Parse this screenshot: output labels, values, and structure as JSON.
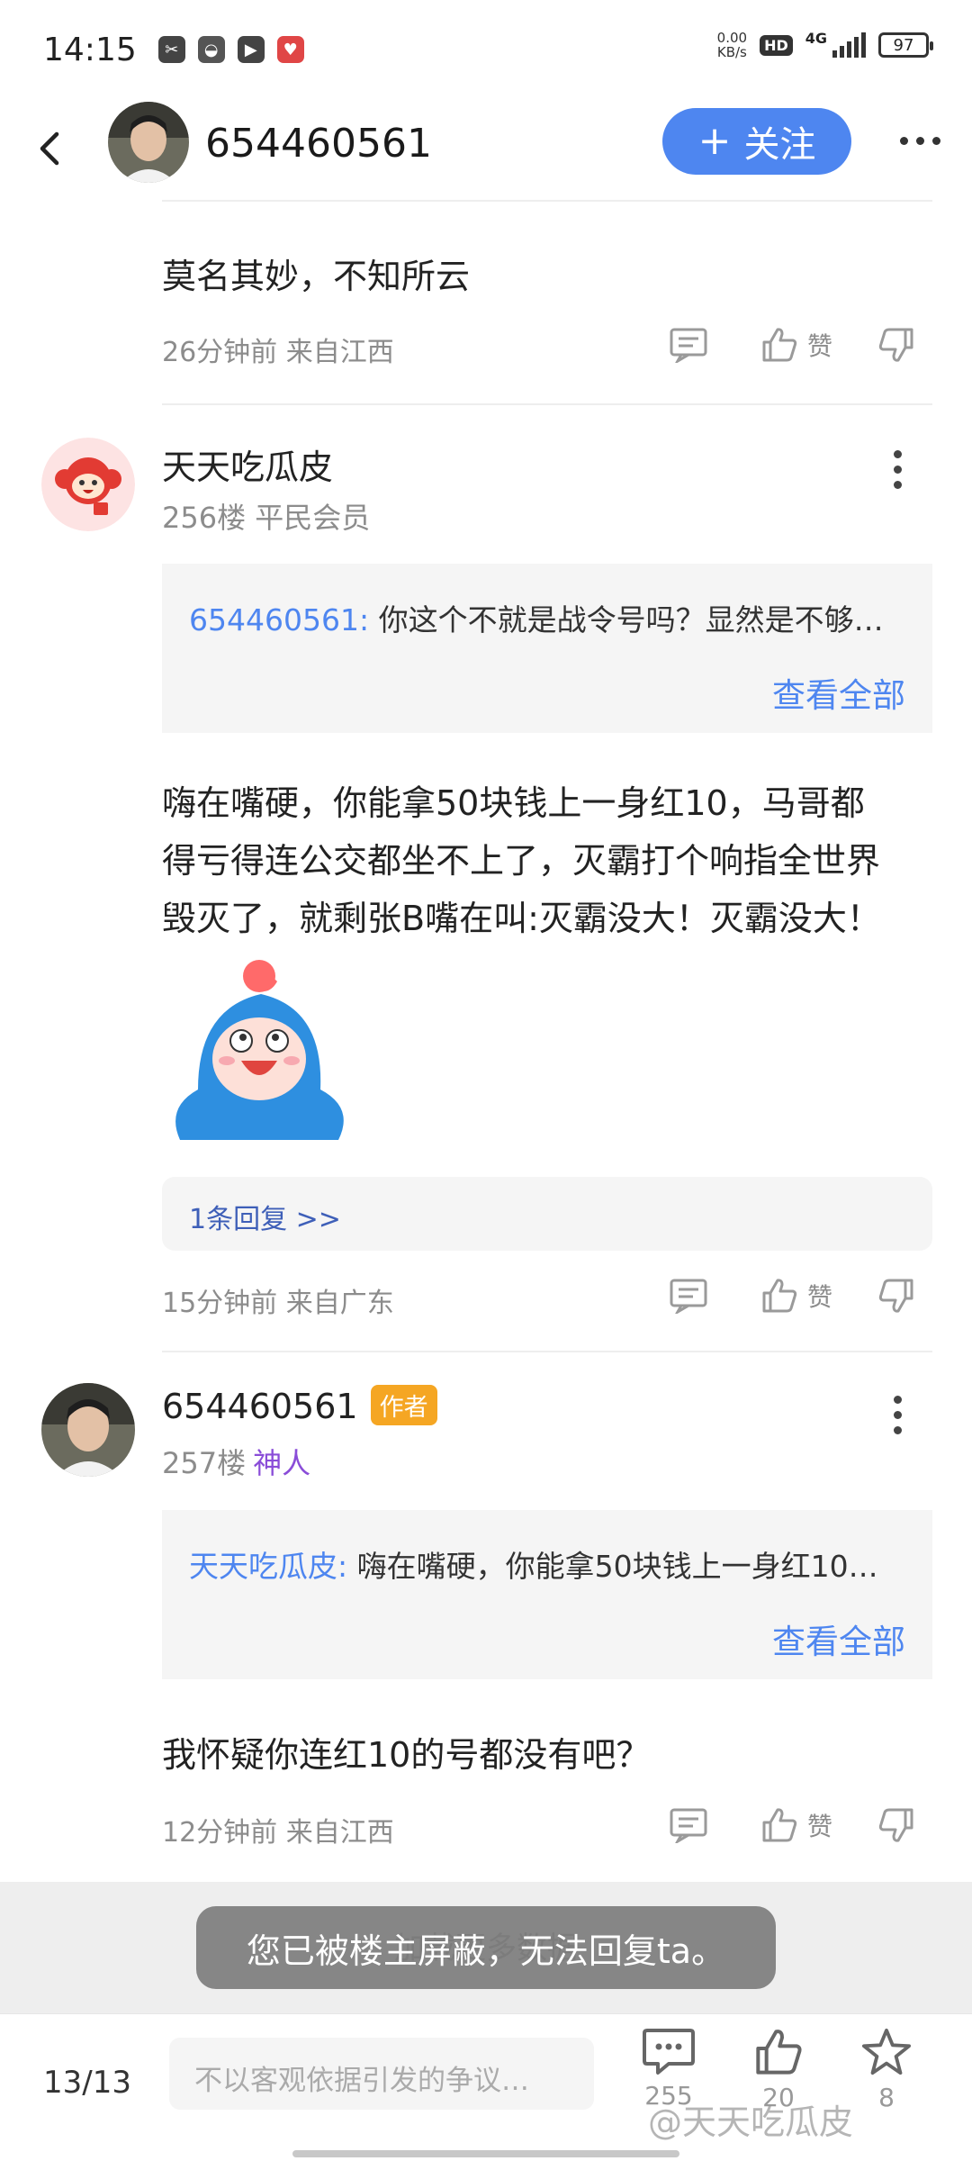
{
  "status": {
    "time": "14:15",
    "net_speed_value": "0.00",
    "net_speed_unit": "KB/s",
    "hd": "HD",
    "network": "4G",
    "battery": "97"
  },
  "header": {
    "username": "654460561",
    "follow_label": "关注",
    "follow_plus": "+"
  },
  "post_top": {
    "text": "莫名其妙，不知所云",
    "meta": "26分钟前 来自江西",
    "like_label": "赞"
  },
  "comment1": {
    "username": "天天吃瓜皮",
    "floor": "256楼 平民会员",
    "quote_author": "654460561:",
    "quote_text": " 你这个不就是战令号吗？显然是不够…",
    "quote_more": "查看全部",
    "body_lines": [
      "嗨在嘴硬，你能拿50块钱上一身红10，马哥都",
      "得亏得连公交都坐不上了，灭霸打个响指全世界",
      "毁灭了，就剩张B嘴在叫:灭霸没大！灭霸没大！"
    ],
    "reply_link": "1条回复 >>",
    "meta": "15分钟前 来自广东",
    "like_label": "赞"
  },
  "comment2": {
    "username": "654460561",
    "badge": "作者",
    "floor": "257楼",
    "rank": "神人",
    "quote_author": "天天吃瓜皮:",
    "quote_text": " 嗨在嘴硬，你能拿50块钱上一身红10…",
    "quote_more": "查看全部",
    "body": "我怀疑你连红10的号都没有吧？",
    "meta": "12分钟前 来自江西",
    "like_label": "赞"
  },
  "load_more": "加载更多数据",
  "toast": "您已被楼主屏蔽，无法回复ta。",
  "bottom": {
    "page": "13/13",
    "input_placeholder": "不以客观依据引发的争议…",
    "comment_count": "255",
    "like_count": "20",
    "fav_count": "8"
  },
  "watermark": "@天天吃瓜皮",
  "colors": {
    "accent": "#4e86f0",
    "author_badge": "#f5a623",
    "rank_purple": "#8a4dd8"
  }
}
